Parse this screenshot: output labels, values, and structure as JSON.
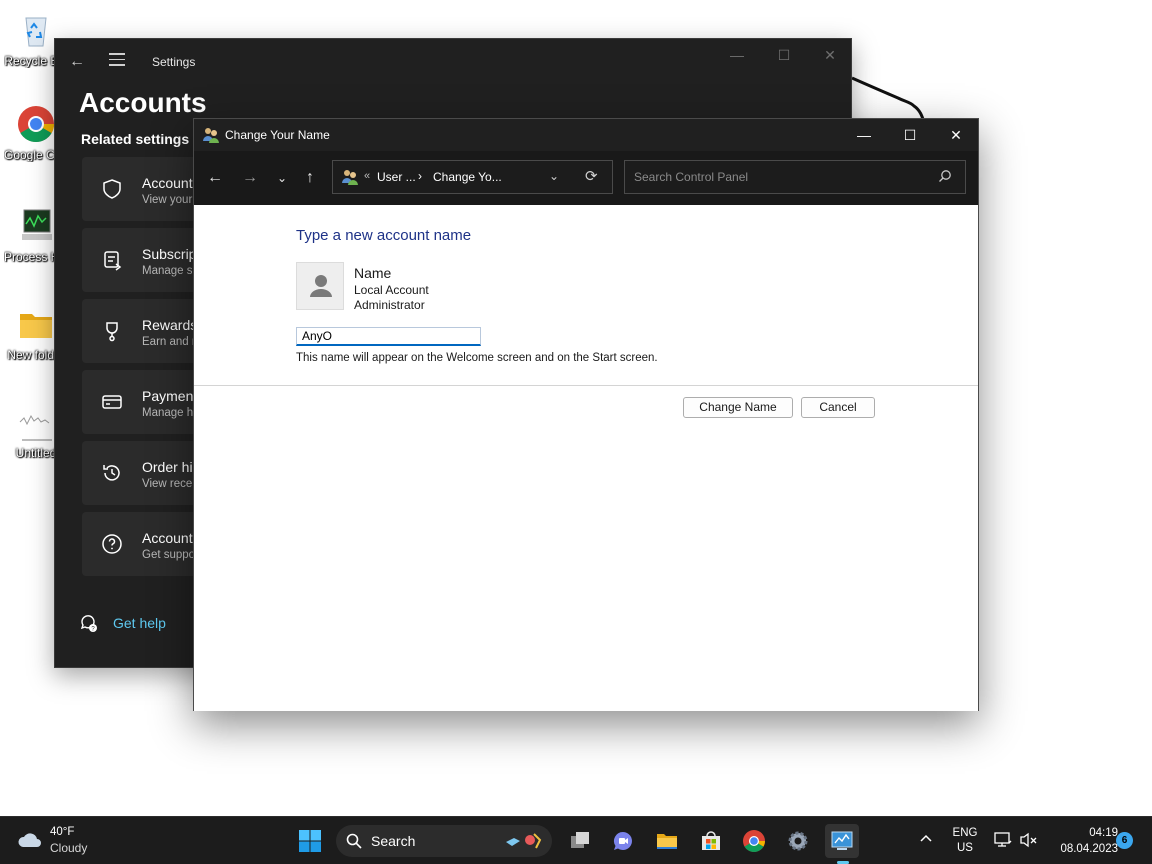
{
  "desktop": {
    "icons": [
      {
        "label": "Recycle Bin"
      },
      {
        "label": "Google Chrome"
      },
      {
        "label": "Process Hacker"
      },
      {
        "label": "New folder"
      },
      {
        "label": "Untitled"
      }
    ]
  },
  "settings": {
    "window_title": "Settings",
    "heading": "Accounts",
    "related_heading": "Related settings",
    "cards": [
      {
        "title": "Account",
        "subtitle": "View your"
      },
      {
        "title": "Subscrip",
        "subtitle": "Manage s"
      },
      {
        "title": "Rewards",
        "subtitle": "Earn and r"
      },
      {
        "title": "Payment",
        "subtitle": "Manage h"
      },
      {
        "title": "Order his",
        "subtitle": "View rece"
      },
      {
        "title": "Account",
        "subtitle": "Get suppo"
      }
    ],
    "get_help": "Get help"
  },
  "dialog": {
    "window_title": "Change Your Name",
    "address": {
      "crumb1": "User ...",
      "crumb2": "Change Yo...",
      "overflow": "«",
      "separator": "›"
    },
    "search_placeholder": "Search Control Panel",
    "heading": "Type a new account name",
    "account": {
      "name": "Name",
      "type": "Local Account",
      "role": "Administrator"
    },
    "name_value": "AnyO",
    "hint": "This name will appear on the Welcome screen and on the Start screen.",
    "buttons": {
      "change": "Change Name",
      "cancel": "Cancel"
    }
  },
  "taskbar": {
    "weather": {
      "temp": "40°F",
      "condition": "Cloudy"
    },
    "search_label": "Search",
    "lang": {
      "line1": "ENG",
      "line2": "US"
    },
    "clock": {
      "time": "04:19",
      "date": "08.04.2023"
    },
    "notification_count": "6"
  },
  "colors": {
    "accent": "#0067c0",
    "dialog_heading": "#1e3287",
    "get_help_link": "#5ec9f0",
    "dark_surface": "#202020"
  }
}
